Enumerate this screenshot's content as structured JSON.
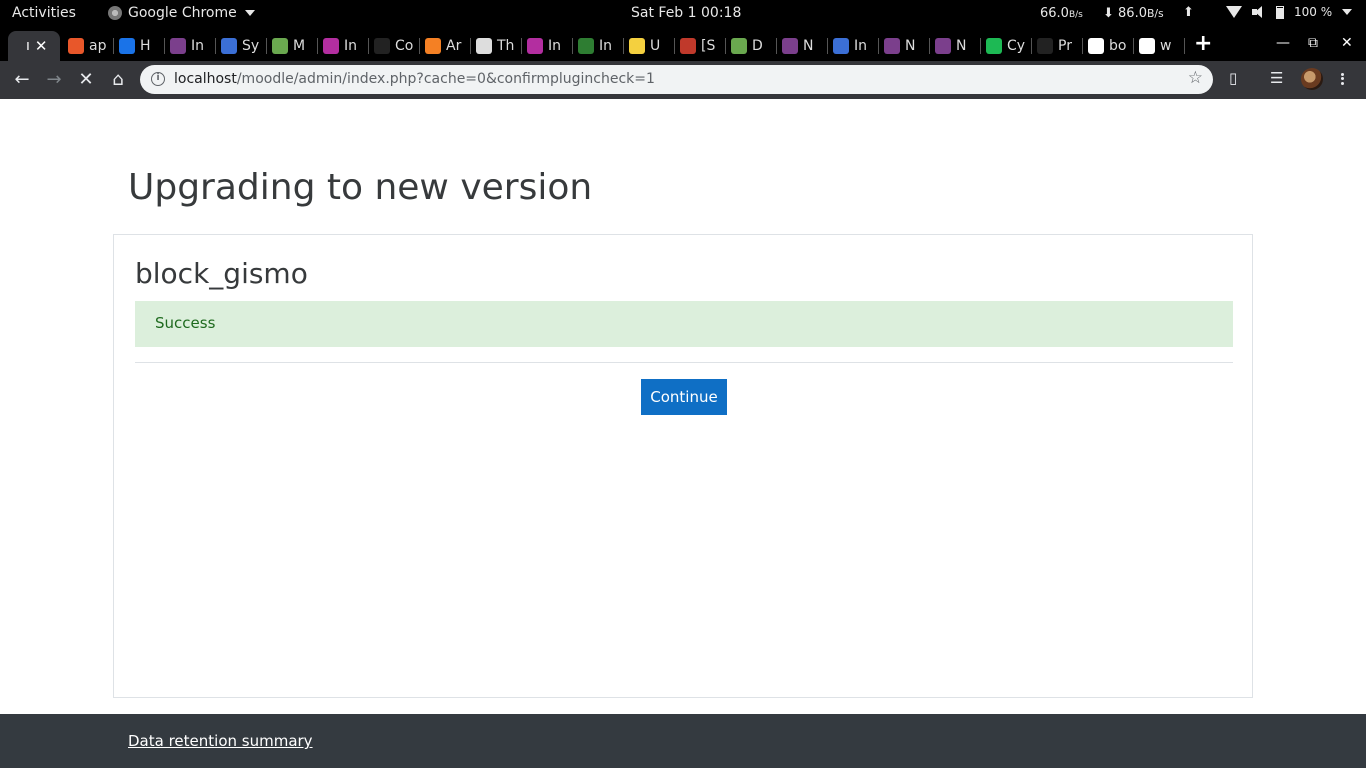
{
  "system_bar": {
    "activities": "Activities",
    "app_name": "Google Chrome",
    "clock": "Sat Feb 1  00:18",
    "upload_rate": "66.0",
    "upload_unit": "B/s",
    "download_rate": "86.0",
    "download_unit": "B/s",
    "battery": "100 %"
  },
  "tabs": [
    {
      "label": "ı",
      "color": "#35363a",
      "active": true
    },
    {
      "label": "ap",
      "color": "#e8572a"
    },
    {
      "label": "H",
      "color": "#1a73e8"
    },
    {
      "label": "In",
      "color": "#7b3f8c"
    },
    {
      "label": "Sy",
      "color": "#3b6fd6"
    },
    {
      "label": "M",
      "color": "#6aa84f"
    },
    {
      "label": "In",
      "color": "#b32ea0"
    },
    {
      "label": "Co",
      "color": "#222222"
    },
    {
      "label": "Ar",
      "color": "#f48024"
    },
    {
      "label": "Th",
      "color": "#dddddd"
    },
    {
      "label": "In",
      "color": "#b32ea0"
    },
    {
      "label": "In",
      "color": "#2e7d32"
    },
    {
      "label": "U",
      "color": "#f4d03f"
    },
    {
      "label": "[S",
      "color": "#c0392b"
    },
    {
      "label": "D",
      "color": "#6aa84f"
    },
    {
      "label": "N",
      "color": "#7b3f8c"
    },
    {
      "label": "In",
      "color": "#3b6fd6"
    },
    {
      "label": "N",
      "color": "#7b3f8c"
    },
    {
      "label": "N",
      "color": "#7b3f8c"
    },
    {
      "label": "Cy",
      "color": "#1db954"
    },
    {
      "label": "Pr",
      "color": "#222222"
    },
    {
      "label": "bo",
      "color": "#ffffff"
    },
    {
      "label": "w",
      "color": "#ffffff"
    }
  ],
  "address_bar": {
    "host": "localhost",
    "path": "/moodle/admin/index.php?cache=0&confirmplugincheck=1"
  },
  "page": {
    "title": "Upgrading to new version",
    "plugin_name": "block_gismo",
    "status_message": "Success",
    "continue_label": "Continue",
    "footer_link": "Data retention summary"
  },
  "colors": {
    "success_bg": "#dcefdc",
    "success_text": "#1e6a1e",
    "primary_button": "#0f6fc5",
    "footer_bg": "#343a40"
  }
}
